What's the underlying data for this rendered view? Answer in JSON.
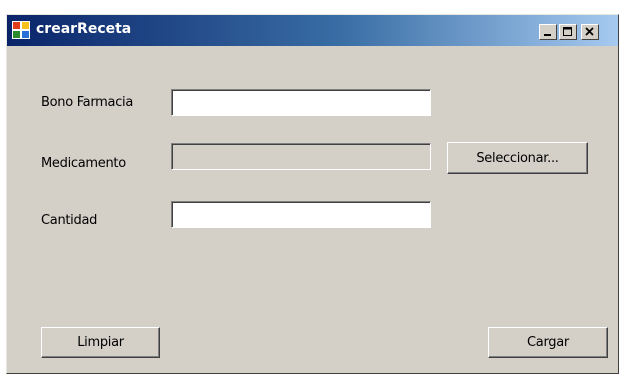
{
  "window": {
    "title": "crearReceta",
    "app_icon": "windows-form-icon",
    "controls": {
      "minimize_icon": "minimize-icon",
      "maximize_icon": "maximize-icon",
      "close_icon": "close-icon"
    }
  },
  "form": {
    "bono_label": "Bono Farmacia",
    "bono_value": "",
    "medicamento_label": "Medicamento",
    "medicamento_value": "",
    "cantidad_label": "Cantidad",
    "cantidad_value": "",
    "select_button": "Seleccionar...",
    "clear_button": "Limpiar",
    "load_button": "Cargar"
  },
  "colors": {
    "face": "#d4d0c8",
    "title_start": "#0a246a",
    "title_end": "#a6caf0"
  }
}
